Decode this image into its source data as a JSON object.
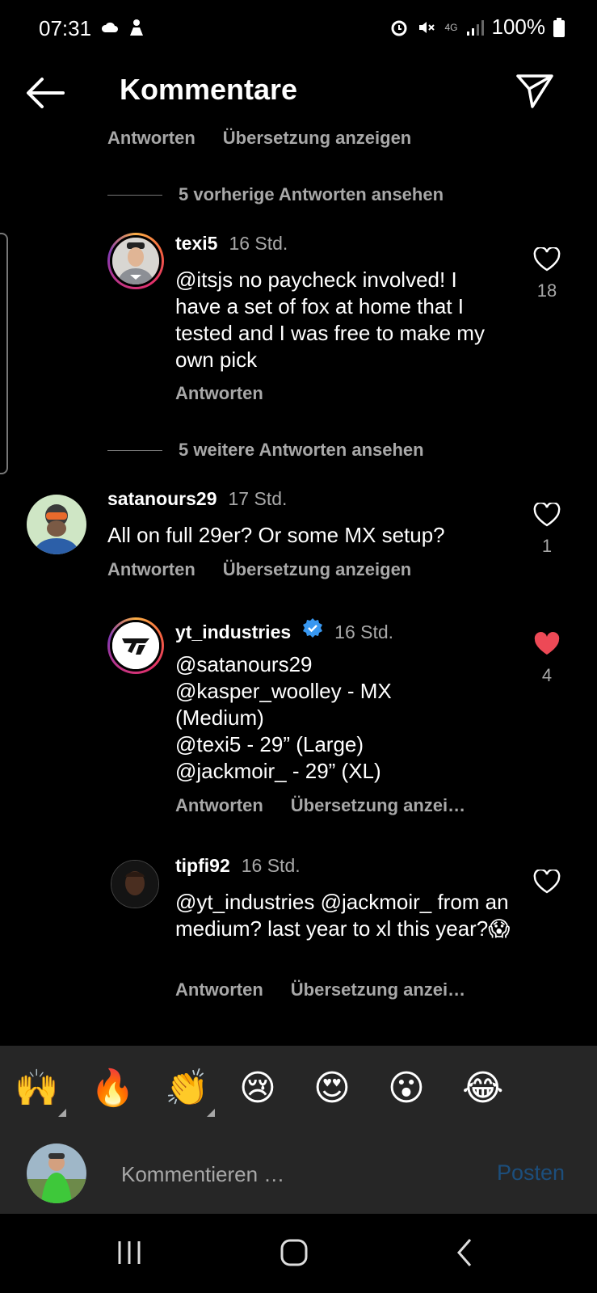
{
  "status_bar": {
    "time": "07:31",
    "battery": "100%",
    "network": "4G",
    "icons": [
      "cloud-icon",
      "app-icon",
      "alarm-icon",
      "mute-icon",
      "data-icon",
      "signal-icon",
      "battery-icon"
    ]
  },
  "header": {
    "title": "Kommentare"
  },
  "feed": {
    "cut_off_actions": {
      "reply": "Antworten",
      "translate": "Übersetzung anzeigen"
    },
    "view_previous": "5 vorherige Antworten ansehen",
    "view_more": "5 weitere Antworten ansehen",
    "comments": [
      {
        "user": "texi5",
        "time": "16 Std.",
        "mention": "@itsjs",
        "text": " no paycheck involved! I have a set of fox at home that I tested and I was free to make my own pick",
        "reply": "Antworten",
        "likes": "18",
        "liked": false
      },
      {
        "user": "satanours29",
        "time": "17 Std.",
        "text": "All on full 29er? Or some MX setup?",
        "reply": "Antworten",
        "translate": "Übersetzung anzeigen",
        "likes": "1",
        "liked": false
      },
      {
        "user": "yt_industries",
        "verified": true,
        "time": "16 Std.",
        "lines": [
          "@satanours29",
          "@kasper_woolley - MX (Medium)",
          "@texi5 - 29” (Large)",
          "@jackmoir_ - 29” (XL)"
        ],
        "reply": "Antworten",
        "translate": "Übersetzung anzei…",
        "likes": "4",
        "liked": true
      },
      {
        "user": "tipfi92",
        "time": "16 Std.",
        "text": "@yt_industries @jackmoir_ from an medium? last year to xl this year?😱",
        "reply": "Antworten",
        "translate": "Übersetzung anzei…",
        "liked": false
      }
    ]
  },
  "emoji_bar": [
    "🙌",
    "🔥",
    "👏",
    "😢",
    "😍",
    "😮",
    "😂"
  ],
  "composer": {
    "placeholder": "Kommentieren …",
    "post_label": "Posten"
  },
  "colors": {
    "background": "#000000",
    "muted_text": "#a8a8a8",
    "liked_heart": "#ed4956",
    "verified_blue": "#3897f0",
    "post_button": "#1c4e7c"
  }
}
